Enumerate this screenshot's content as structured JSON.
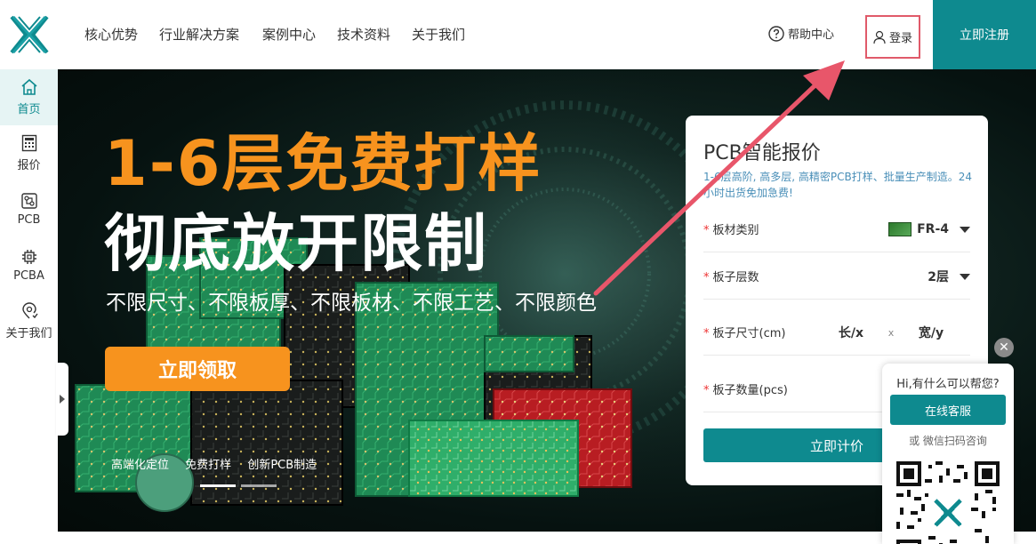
{
  "header": {
    "nav": [
      "核心优势",
      "行业解决方案",
      "案例中心",
      "技术资料",
      "关于我们"
    ],
    "help_label": "帮助中心",
    "login_label": "登录",
    "register_label": "立即注册"
  },
  "sidebar": {
    "items": [
      {
        "label": "首页",
        "icon": "home-icon",
        "active": true
      },
      {
        "label": "报价",
        "icon": "calculator-icon",
        "active": false
      },
      {
        "label": "PCB",
        "icon": "pcb-icon",
        "active": false
      },
      {
        "label": "PCBA",
        "icon": "chip-icon",
        "active": false
      },
      {
        "label": "关于我们",
        "icon": "location-icon",
        "active": false
      }
    ]
  },
  "hero": {
    "headline1": "1-6层免费打样",
    "headline2": "彻底放开限制",
    "subline": "不限尺寸、不限板厚、不限板材、不限工艺、不限颜色",
    "cta_label": "立即领取",
    "features": [
      "高端化定位",
      "免费打样",
      "创新PCB制造"
    ]
  },
  "quote": {
    "title": "PCB智能报价",
    "desc": "1-6层高阶, 高多层, 高精密PCB打样、批量生产制造。24小时出货免加急费!",
    "required_mark": "*",
    "rows": [
      {
        "label": "板材类别",
        "value": "FR-4"
      },
      {
        "label": "板子层数",
        "value": "2层"
      },
      {
        "label": "板子尺寸(cm)",
        "length": "长/x",
        "sep": "x",
        "width": "宽/y"
      },
      {
        "label": "板子数量(pcs)",
        "value": ""
      }
    ],
    "submit_label": "立即计价"
  },
  "chat": {
    "greeting": "Hi,有什么可以帮您?",
    "online_label": "在线客服",
    "or_label": "或 微信扫码咨询",
    "close_glyph": "✕"
  },
  "colors": {
    "brand_teal": "#0e8a8f",
    "accent_orange": "#f7931e",
    "annotation_red": "#e8566a"
  }
}
